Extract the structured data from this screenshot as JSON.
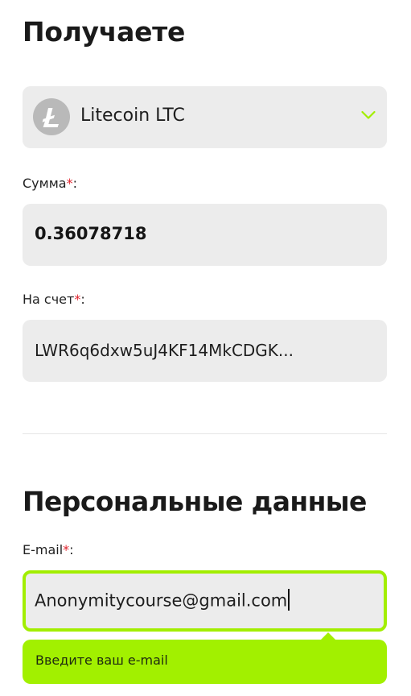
{
  "receive_section": {
    "title": "Получаете",
    "currency": {
      "name": "Litecoin LTC",
      "icon": "litecoin-icon",
      "icon_bg_color": "#b9b9b9"
    },
    "amount": {
      "label": "Сумма",
      "required_mark": "*",
      "label_suffix": ":",
      "value": "0.36078718"
    },
    "account": {
      "label": "На счет",
      "required_mark": "*",
      "label_suffix": ":",
      "value": "LWR6q6dxw5uJ4KF14MkCDGK..."
    }
  },
  "personal_section": {
    "title": "Персональные данные",
    "email": {
      "label": "E-mail",
      "required_mark": "*",
      "label_suffix": ":",
      "value": "Anonymitycourse@gmail.com"
    },
    "tooltip": {
      "text": "Введите ваш e-mail"
    }
  },
  "colors": {
    "accent": "#a2ee00",
    "required": "#e0212b",
    "field_bg": "#ececec"
  }
}
